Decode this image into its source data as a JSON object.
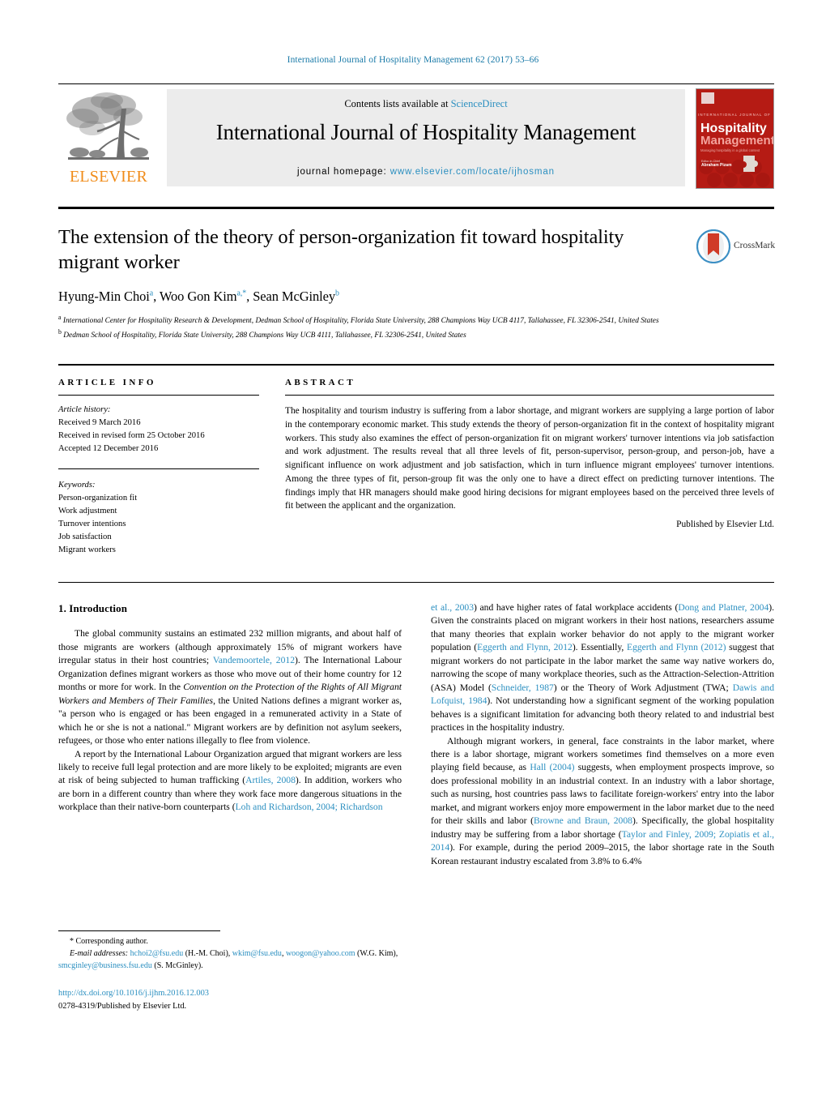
{
  "running_head": "International Journal of Hospitality Management 62 (2017) 53–66",
  "masthead": {
    "publisher_name": "ELSEVIER",
    "contents_prefix": "Contents lists available at ",
    "contents_link": "ScienceDirect",
    "journal_title": "International Journal of Hospitality Management",
    "homepage_prefix": "journal homepage: ",
    "homepage_url": "www.elsevier.com/locate/ijhosman",
    "cover": {
      "line1": "INTERNATIONAL JOURNAL OF",
      "line2": "Hospitality",
      "line3": "Management",
      "line4": "Managing hospitality in a global context",
      "line5": "Editor-in-Chief",
      "line6": "Abraham Pizam"
    }
  },
  "article": {
    "title": "The extension of the theory of person-organization fit toward hospitality migrant worker",
    "authors": [
      {
        "name": "Hyung-Min Choi",
        "sup": "a"
      },
      {
        "name": "Woo Gon Kim",
        "sup": "a,*"
      },
      {
        "name": "Sean McGinley",
        "sup": "b"
      }
    ],
    "affiliations": [
      {
        "sup": "a",
        "text": "International Center for Hospitality Research & Development, Dedman School of Hospitality, Florida State University, 288 Champions Way UCB 4117, Tallahassee, FL 32306-2541, United States"
      },
      {
        "sup": "b",
        "text": "Dedman School of Hospitality, Florida State University, 288 Champions Way UCB 4111, Tallahassee, FL 32306-2541, United States"
      }
    ],
    "crossmark_label": "CrossMark"
  },
  "article_info": {
    "heading": "ARTICLE INFO",
    "history_label": "Article history:",
    "history": [
      "Received 9 March 2016",
      "Received in revised form 25 October 2016",
      "Accepted 12 December 2016"
    ],
    "keywords_label": "Keywords:",
    "keywords": [
      "Person-organization fit",
      "Work adjustment",
      "Turnover intentions",
      "Job satisfaction",
      "Migrant workers"
    ]
  },
  "abstract": {
    "heading": "ABSTRACT",
    "text": "The hospitality and tourism industry is suffering from a labor shortage, and migrant workers are supplying a large portion of labor in the contemporary economic market. This study extends the theory of person-organization fit in the context of hospitality migrant workers. This study also examines the effect of person-organization fit on migrant workers' turnover intentions via job satisfaction and work adjustment. The results reveal that all three levels of fit, person-supervisor, person-group, and person-job, have a significant influence on work adjustment and job satisfaction, which in turn influence migrant employees' turnover intentions. Among the three types of fit, person-group fit was the only one to have a direct effect on predicting turnover intentions. The findings imply that HR managers should make good hiring decisions for migrant employees based on the perceived three levels of fit between the applicant and the organization.",
    "publisher_line": "Published by Elsevier Ltd."
  },
  "body": {
    "section_heading": "1. Introduction",
    "left_column": {
      "para1_a": "The global community sustains an estimated 232 million migrants, and about half of those migrants are workers (although approximately 15% of migrant workers have irregular status in their host countries; ",
      "para1_ref1": "Vandemoortele, 2012",
      "para1_b": "). The International Labour Organization defines migrant workers as those who move out of their home country for 12 months or more for work. In the ",
      "para1_italic": "Convention on the Protection of the Rights of All Migrant Workers and Members of Their Families",
      "para1_c": ", the United Nations defines a migrant worker as, \"a person who is engaged or has been engaged in a remunerated activity in a State of which he or she is not a national.\" Migrant workers are by definition not asylum seekers, refugees, or those who enter nations illegally to flee from violence.",
      "para2_a": "A report by the International Labour Organization argued that migrant workers are less likely to receive full legal protection and are more likely to be exploited; migrants are even at risk of being subjected to human trafficking (",
      "para2_ref1": "Artiles, 2008",
      "para2_b": "). In addition, workers who are born in a different country than where they work face more dangerous situations in the workplace than their native-born counterparts (",
      "para2_ref2": "Loh and Richardson, 2004; Richardson"
    },
    "right_column": {
      "cont_ref": "et al., 2003",
      "cont_a": ") and have higher rates of fatal workplace accidents (",
      "cont_ref2": "Dong and Platner, 2004",
      "cont_b": "). Given the constraints placed on migrant workers in their host nations, researchers assume that many theories that explain worker behavior do not apply to the migrant worker population (",
      "cont_ref3": "Eggerth and Flynn, 2012",
      "cont_c": "). Essentially, ",
      "cont_ref4": "Eggerth and Flynn (2012)",
      "cont_d": " suggest that migrant workers do not participate in the labor market the same way native workers do, narrowing the scope of many workplace theories, such as the Attraction-Selection-Attrition (ASA) Model (",
      "cont_ref5": "Schneider, 1987",
      "cont_e": ") or the Theory of Work Adjustment (TWA; ",
      "cont_ref6": "Dawis and Lofquist, 1984",
      "cont_f": "). Not understanding how a significant segment of the working population behaves is a significant limitation for advancing both theory related to and industrial best practices in the hospitality industry.",
      "para2_a": "Although migrant workers, in general, face constraints in the labor market, where there is a labor shortage, migrant workers sometimes find themselves on a more even playing field because, as ",
      "para2_ref1": "Hall (2004)",
      "para2_b": " suggests, when employment prospects improve, so does professional mobility in an industrial context. In an industry with a labor shortage, such as nursing, host countries pass laws to facilitate foreign-workers' entry into the labor market, and migrant workers enjoy more empowerment in the labor market due to the need for their skills and labor (",
      "para2_ref2": "Browne and Braun, 2008",
      "para2_c": "). Specifically, the global hospitality industry may be suffering from a labor shortage (",
      "para2_ref3": "Taylor and Finley, 2009; Zopiatis et al., 2014",
      "para2_d": "). For example, during the period 2009–2015, the labor shortage rate in the South Korean restaurant industry escalated from 3.8% to 6.4%"
    }
  },
  "footnotes": {
    "corresponding": "* Corresponding author.",
    "email_label": "E-mail addresses:",
    "emails": [
      {
        "addr": "hchoi2@fsu.edu",
        "who": " (H.-M. Choi), "
      },
      {
        "addr": "wkim@fsu.edu",
        "who": ", "
      },
      {
        "addr": "woogon@yahoo.com",
        "who": " (W.G. Kim), "
      },
      {
        "addr": "smcginley@business.fsu.edu",
        "who": " (S. McGinley)."
      }
    ],
    "doi": "http://dx.doi.org/10.1016/j.ijhm.2016.12.003",
    "issn_line": "0278-4319/Published by Elsevier Ltd."
  },
  "colors": {
    "link_blue": "#2b8fc0",
    "elsevier_orange": "#F08C1A",
    "cover_red": "#b51b14"
  }
}
